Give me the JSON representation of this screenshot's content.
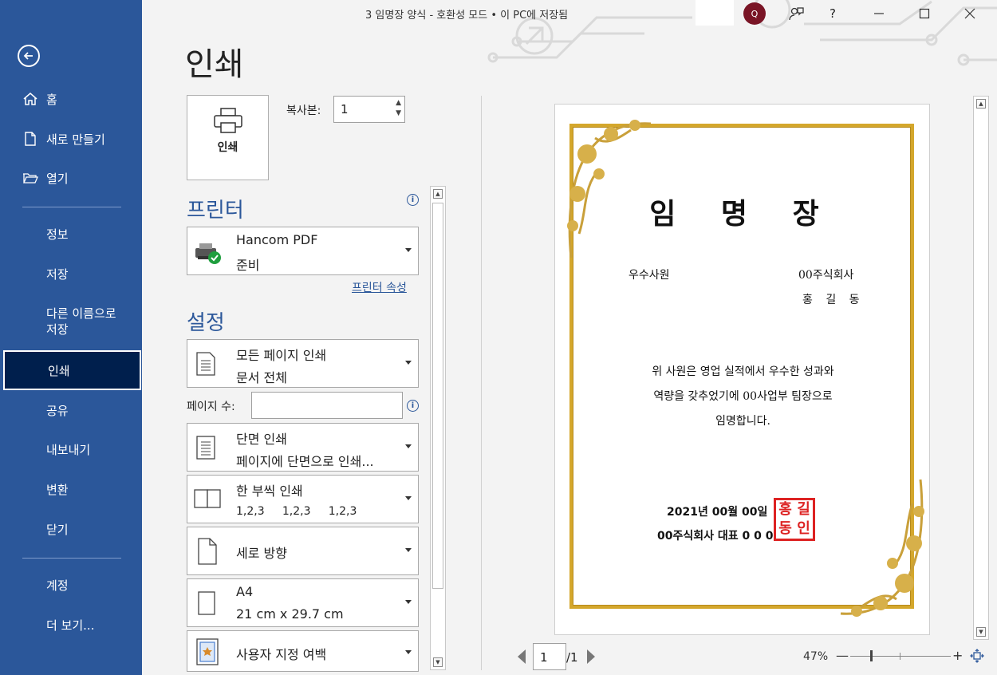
{
  "titlebar": {
    "title": "3 임명장 양식  -  호환성 모드 • 이 PC에 저장됨",
    "avatar_initial": "Q",
    "help": "?",
    "minimize": "—",
    "close": "✕"
  },
  "sidebar": {
    "items": [
      {
        "label": "홈"
      },
      {
        "label": "새로 만들기"
      },
      {
        "label": "열기"
      },
      {
        "label": "정보"
      },
      {
        "label": "저장"
      },
      {
        "label": "다른 이름으로\n저장"
      },
      {
        "label": "인쇄"
      },
      {
        "label": "공유"
      },
      {
        "label": "내보내기"
      },
      {
        "label": "변환"
      },
      {
        "label": "닫기"
      },
      {
        "label": "계정"
      },
      {
        "label": "더 보기..."
      }
    ]
  },
  "print": {
    "heading": "인쇄",
    "print_button": "인쇄",
    "copies_label": "복사본:",
    "copies_value": "1",
    "printer_section": "프린터",
    "printer_name": "Hancom PDF",
    "printer_status": "준비",
    "printer_props": "프린터 속성",
    "settings_section": "설정",
    "range_l1": "모든 페이지 인쇄",
    "range_l2": "문서 전체",
    "pages_label": "페이지 수:",
    "pages_value": "",
    "sides_l1": "단면 인쇄",
    "sides_l2": "페이지에 단면으로 인쇄...",
    "collate_l1": "한 부씩 인쇄",
    "collate_l2": "1,2,3     1,2,3     1,2,3",
    "orientation": "세로 방향",
    "paper_l1": "A4",
    "paper_l2": "21 cm x 29.7 cm",
    "margins": "사용자 지정 여백"
  },
  "preview": {
    "title": "임 명 장",
    "left_label": "우수사원",
    "company": "00주식회사",
    "name": "홍 길 동",
    "body_lines": [
      "위 사원은 영업 실적에서 우수한 성과와",
      "역량을 갖추었기에 00사업부 팀장으로",
      "임명합니다."
    ],
    "date": "2021년 00월 00일",
    "rep": "00주식회사 대표 0 0 0",
    "seal": [
      "홍",
      "길",
      "동",
      "인"
    ]
  },
  "pagenav": {
    "current": "1",
    "total": "/1"
  },
  "zoom": {
    "label": "47%",
    "minus": "—",
    "plus": "+",
    "level_percent": 47
  },
  "colors": {
    "sidebar": "#2b579a",
    "active": "#001f4d",
    "accent": "#2b579a",
    "gold": "#d4a72c",
    "seal": "#dd2222"
  }
}
